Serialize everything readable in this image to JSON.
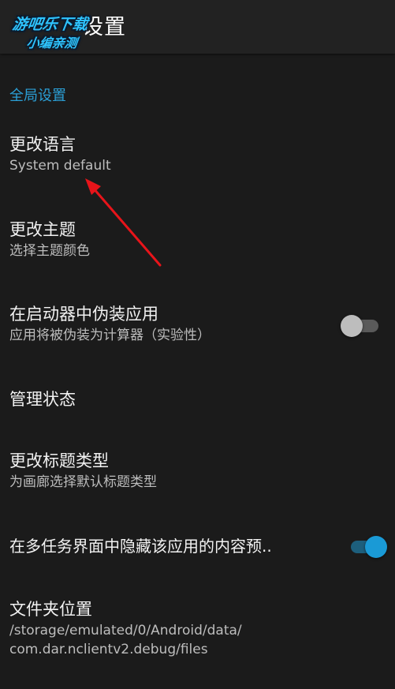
{
  "appbar": {
    "title": "设置"
  },
  "watermark": {
    "line1": "游吧乐下载",
    "line2": "小编亲测"
  },
  "category": {
    "label": "全局设置"
  },
  "preferences": [
    {
      "title": "更改语言",
      "summary": "System default"
    },
    {
      "title": "更改主题",
      "summary": "选择主题颜色"
    },
    {
      "title": "在启动器中伪装应用",
      "summary": "应用将被伪装为计算器（实验性）",
      "switch": "off"
    },
    {
      "title": "管理状态",
      "summary": ""
    },
    {
      "title": "更改标题类型",
      "summary": "为画廊选择默认标题类型"
    },
    {
      "title": "在多任务界面中隐藏该应用的内容预..",
      "summary": "",
      "switch": "on"
    },
    {
      "title": "文件夹位置",
      "summary_line1": "/storage/emulated/0/Android/data/",
      "summary_line2": "com.dar.nclientv2.debug/files"
    }
  ],
  "colors": {
    "background": "#1b1b1b",
    "appbar": "#222222",
    "accent": "#2b9fd6",
    "annotation_arrow": "#e8141a"
  }
}
